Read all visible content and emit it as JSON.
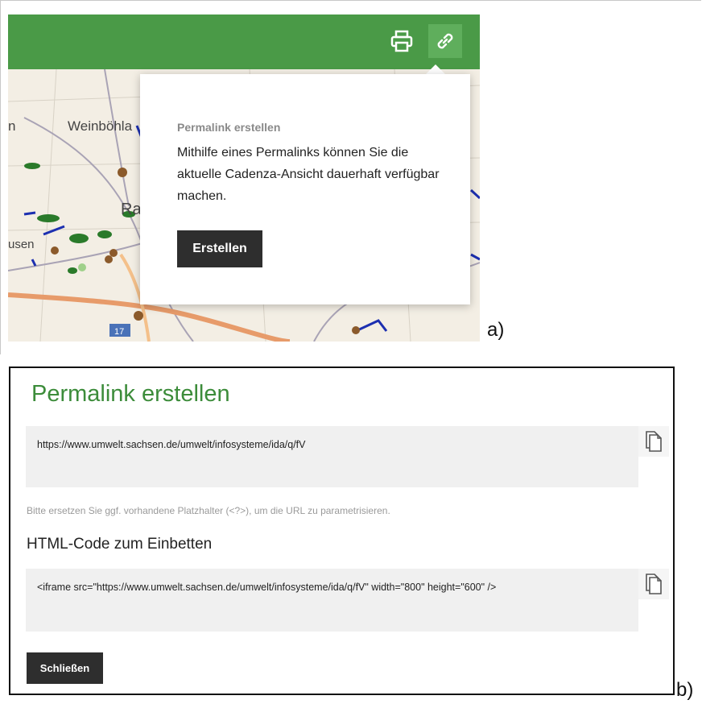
{
  "panel_a": {
    "label": "a)",
    "toolbar": {
      "print_icon": "printer-icon",
      "link_icon": "link-icon",
      "color": "#4a9a47"
    },
    "map_labels": {
      "town1": "Weinböhla",
      "town2": "Rad",
      "town3": "usen",
      "town4": "n",
      "road": "17"
    },
    "popover": {
      "title": "Permalink erstellen",
      "text": "Mithilfe eines Permalinks können Sie die aktuelle Cadenza-Ansicht dauerhaft verfügbar machen.",
      "button": "Erstellen"
    }
  },
  "panel_b": {
    "label": "b)",
    "title": "Permalink erstellen",
    "url": "https://www.umwelt.sachsen.de/umwelt/infosysteme/ida/q/fV",
    "hint": "Bitte ersetzen Sie ggf. vorhandene Platzhalter (<?>), um die URL zu parametrisieren.",
    "embed_heading": "HTML-Code zum Einbetten",
    "embed_code": "<iframe src=\"https://www.umwelt.sachsen.de/umwelt/infosysteme/ida/q/fV\" width=\"800\" height=\"600\" />",
    "close_button": "Schließen",
    "copy_icon": "copy-icon",
    "title_color": "#3c8c3a"
  }
}
